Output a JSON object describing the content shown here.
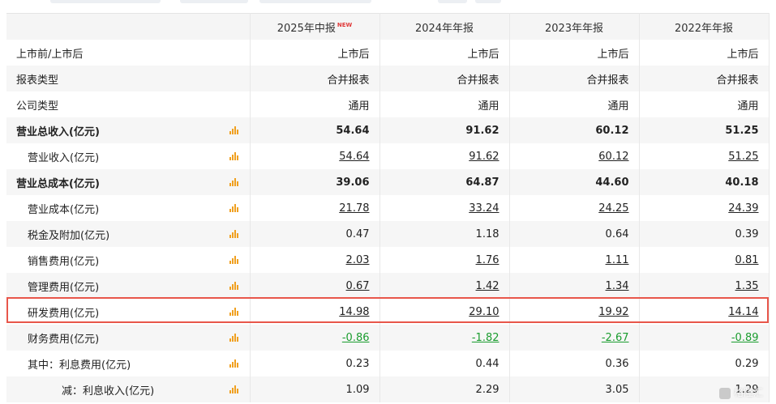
{
  "columns": [
    {
      "label": "2025年中报",
      "badge": "NEW"
    },
    {
      "label": "2024年年报"
    },
    {
      "label": "2023年年报"
    },
    {
      "label": "2022年年报"
    }
  ],
  "rows": [
    {
      "name": "上市前/上市后",
      "values": [
        "上市后",
        "上市后",
        "上市后",
        "上市后"
      ]
    },
    {
      "name": "报表类型",
      "values": [
        "合并报表",
        "合并报表",
        "合并报表",
        "合并报表"
      ]
    },
    {
      "name": "公司类型",
      "values": [
        "通用",
        "通用",
        "通用",
        "通用"
      ]
    },
    {
      "name": "营业总收入(亿元)",
      "values": [
        "54.64",
        "91.62",
        "60.12",
        "51.25"
      ]
    },
    {
      "name": "营业收入(亿元)",
      "values": [
        "54.64",
        "91.62",
        "60.12",
        "51.25"
      ]
    },
    {
      "name": "营业总成本(亿元)",
      "values": [
        "39.06",
        "64.87",
        "44.60",
        "40.18"
      ]
    },
    {
      "name": "营业成本(亿元)",
      "values": [
        "21.78",
        "33.24",
        "24.25",
        "24.39"
      ]
    },
    {
      "name": "税金及附加(亿元)",
      "values": [
        "0.47",
        "1.18",
        "0.64",
        "0.39"
      ]
    },
    {
      "name": "销售费用(亿元)",
      "values": [
        "2.03",
        "1.76",
        "1.11",
        "0.81"
      ]
    },
    {
      "name": "管理费用(亿元)",
      "values": [
        "0.67",
        "1.42",
        "1.34",
        "1.35"
      ]
    },
    {
      "name": "研发费用(亿元)",
      "values": [
        "14.98",
        "29.10",
        "19.92",
        "14.14"
      ]
    },
    {
      "name": "财务费用(亿元)",
      "values": [
        "-0.86",
        "-1.82",
        "-2.67",
        "-0.89"
      ]
    },
    {
      "name": "其中：利息费用(亿元)",
      "values": [
        "0.23",
        "0.44",
        "0.36",
        "0.29"
      ]
    },
    {
      "name": "减：利息收入(亿元)",
      "values": [
        "1.09",
        "2.29",
        "3.05",
        "1.29"
      ]
    }
  ],
  "colors": {
    "negative": "#1a9c2e",
    "highlight_border": "#e8564a",
    "chart_icon": "#f0a020"
  },
  "watermark": "格隆汇"
}
